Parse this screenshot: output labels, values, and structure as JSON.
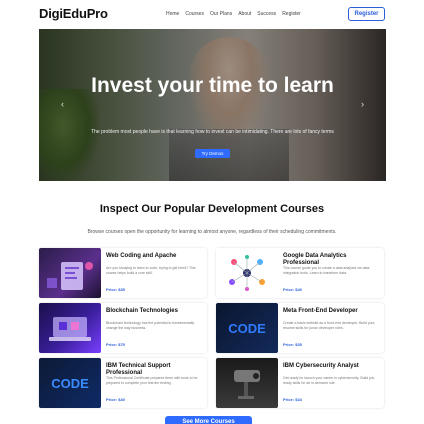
{
  "brand": {
    "name": "DigiEduPro"
  },
  "nav": {
    "items": [
      "Home",
      "Courses",
      "Our Plans",
      "About",
      "Success",
      "Register"
    ],
    "register_button": "Register"
  },
  "hero": {
    "heading": "Invest your time to learn",
    "subtext": "The problem most people have is that learning how to invest can be intimidating. There are lots of fancy terms",
    "cta": "Try Demos",
    "prev_glyph": "‹",
    "next_glyph": "›"
  },
  "courses_section": {
    "title": "Inspect Our Popular Development Courses",
    "subtitle": "Browse courses open the opportunity for learning to almost anyone, regardless of their scheduling commitments."
  },
  "courses": [
    {
      "title": "Web Coding and Apache",
      "description": "Are you studying to learn to code, trying to get hired? This course helps build a core skill.",
      "price": "Price: $35",
      "thumb": "web-coding"
    },
    {
      "title": "Google Data Analytics Professional",
      "description": "This course guide you to create a data analysis via data integration tools. Learn to transform data.",
      "price": "Price: $40",
      "thumb": "data-analytics"
    },
    {
      "title": "Blockchain Technologies",
      "description": "Blockchain technology has the potential to fundamentally change the way business.",
      "price": "Price: $75",
      "thumb": "blockchain"
    },
    {
      "title": "Meta Front-End Developer",
      "description": "Create a basic website as a front-end developer. Build your resume skills for junior developer roles.",
      "price": "Price: $35",
      "thumb": "code-blue"
    },
    {
      "title": "IBM Technical Support Professional",
      "description": "This Professional Certificate prepares them with tools to be prepared to complete your first tier testing.",
      "price": "Price: $40",
      "thumb": "code-dark"
    },
    {
      "title": "IBM Cybersecurity Analyst",
      "description": "Get ready for launch your career in cybersecurity. Build job-ready skills for an in-demand role.",
      "price": "Price: $34",
      "thumb": "cybersecurity"
    }
  ],
  "see_more": "See More Courses"
}
